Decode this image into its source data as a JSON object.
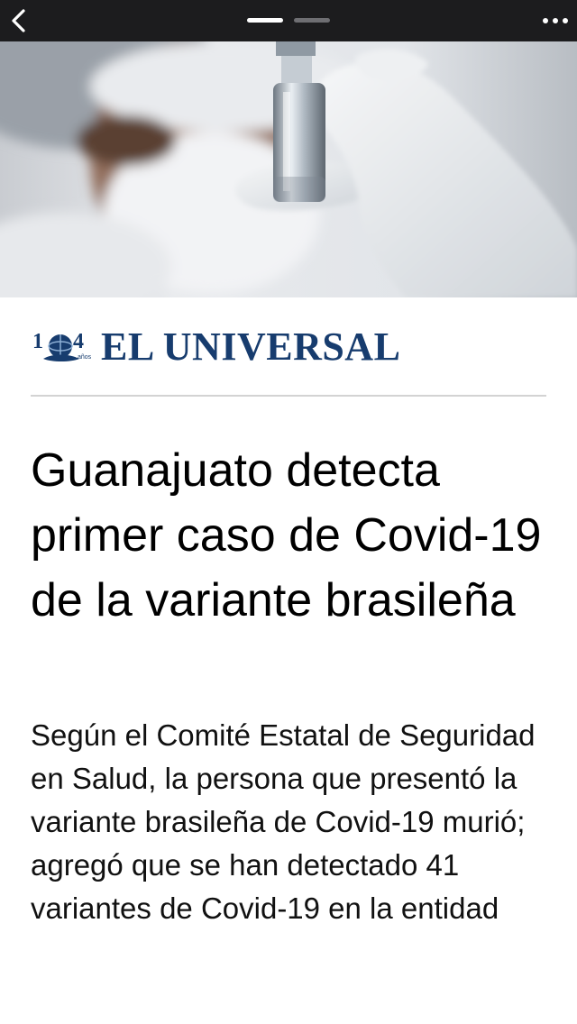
{
  "nav": {
    "back_icon": "chevron-left-icon",
    "more_icon": "more-horizontal-icon",
    "pages_total": 2,
    "page_current": 1
  },
  "hero_image": {
    "description_icon": "vaccine-vial-photo"
  },
  "brand": {
    "name": "EL UNIVERSAL",
    "anniversary_number": "104",
    "anniversary_word": "años",
    "color": "#173c6e"
  },
  "article": {
    "headline": "Guanajuato detecta primer caso de Covid-19 de la variante brasileña",
    "summary": "Según el Comité Estatal de Seguridad en Salud, la persona que presentó la variante brasileña de Covid-19 murió; agregó que se han detectado 41 variantes de Covid-19 en la entidad"
  }
}
